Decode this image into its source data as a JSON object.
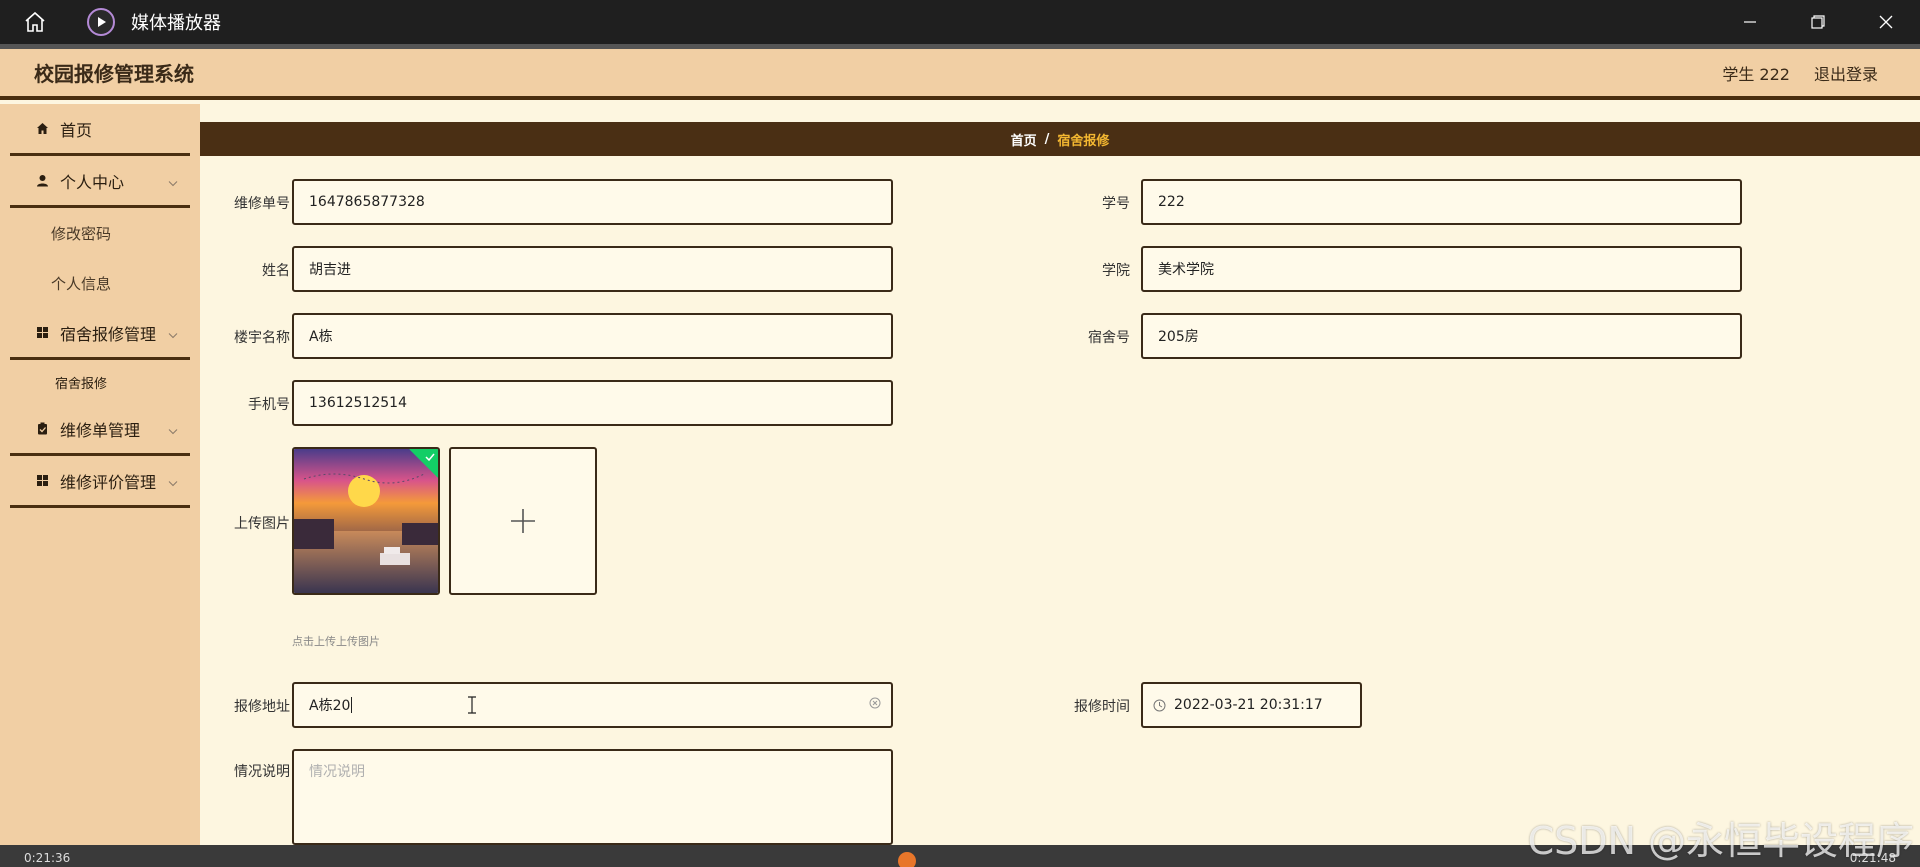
{
  "window": {
    "app_title": "媒体播放器",
    "icons": {
      "home": "home-icon",
      "app": "play-icon",
      "minimize": "minimize-icon",
      "restore": "restore-icon",
      "close": "close-icon"
    }
  },
  "header": {
    "brand": "校园报修管理系统",
    "user": "学生 222",
    "logout": "退出登录"
  },
  "sidebar": {
    "items": [
      {
        "label": "首页",
        "icon": "home-icon"
      },
      {
        "label": "个人中心",
        "icon": "user-icon"
      },
      {
        "label": "修改密码"
      },
      {
        "label": "个人信息"
      },
      {
        "label": "宿舍报修管理",
        "icon": "grid-icon"
      },
      {
        "label": "宿舍报修"
      },
      {
        "label": "维修单管理",
        "icon": "clipboard-icon"
      },
      {
        "label": "维修评价管理",
        "icon": "grid-icon"
      }
    ]
  },
  "breadcrumb": {
    "home": "首页",
    "separator": "/",
    "current": "宿舍报修"
  },
  "form": {
    "repair_no": {
      "label": "维修单号",
      "value": "1647865877328"
    },
    "student_no": {
      "label": "学号",
      "value": "222"
    },
    "name": {
      "label": "姓名",
      "value": "胡吉进"
    },
    "college": {
      "label": "学院",
      "value": "美术学院"
    },
    "building": {
      "label": "楼宇名称",
      "value": "A栋"
    },
    "dorm_no": {
      "label": "宿舍号",
      "value": "205房"
    },
    "phone": {
      "label": "手机号",
      "value": "13612512514"
    },
    "upload": {
      "label": "上传图片",
      "hint": "点击上传上传图片"
    },
    "address": {
      "label": "报修地址",
      "value": "A栋20"
    },
    "time": {
      "label": "报修时间",
      "value": "2022-03-21 20:31:17"
    },
    "description": {
      "label": "情况说明",
      "placeholder": "情况说明"
    }
  },
  "player": {
    "elapsed": "0:21:36",
    "total": "0:21:48"
  },
  "watermark": "CSDN @永恒毕设程序",
  "colors": {
    "sidebar": "#f1cfa4",
    "accent": "#4a2f14",
    "highlight": "#f3b731",
    "background": "#fdf6e0"
  }
}
